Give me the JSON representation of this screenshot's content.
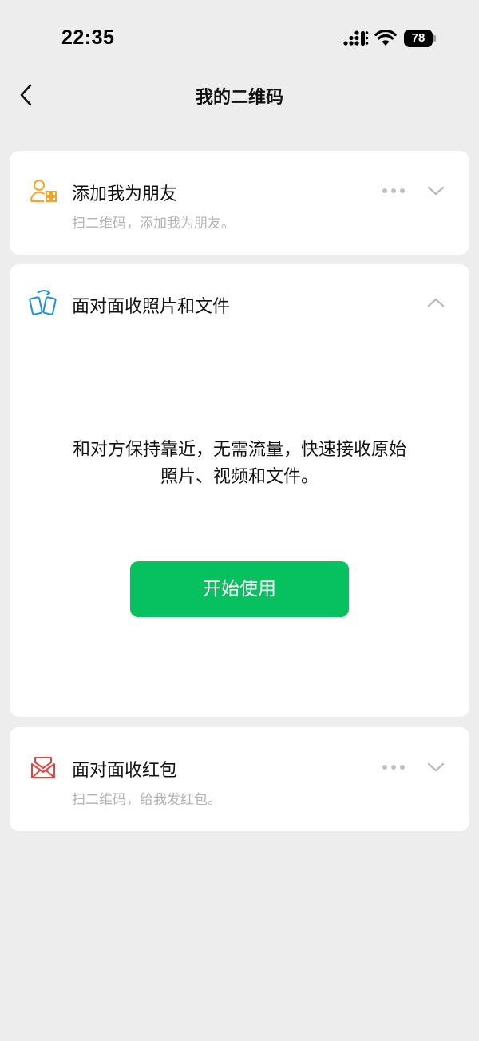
{
  "status_bar": {
    "time": "22:35",
    "battery": "78"
  },
  "nav": {
    "title": "我的二维码"
  },
  "cards": [
    {
      "title": "添加我为朋友",
      "subtitle": "扫二维码，添加我为朋友。",
      "icon": "add-friend-qr-icon",
      "accent": "#f5a623"
    },
    {
      "title": "面对面收照片和文件",
      "description_line1": "和对方保持靠近，无需流量，快速接收原始",
      "description_line2": "照片、视频和文件。",
      "button": "开始使用",
      "icon": "phones-transfer-icon",
      "accent": "#1e8fe1",
      "button_color": "#07c160"
    },
    {
      "title": "面对面收红包",
      "subtitle": "扫二维码，给我发红包。",
      "icon": "red-packet-icon",
      "accent": "#e64340"
    }
  ]
}
